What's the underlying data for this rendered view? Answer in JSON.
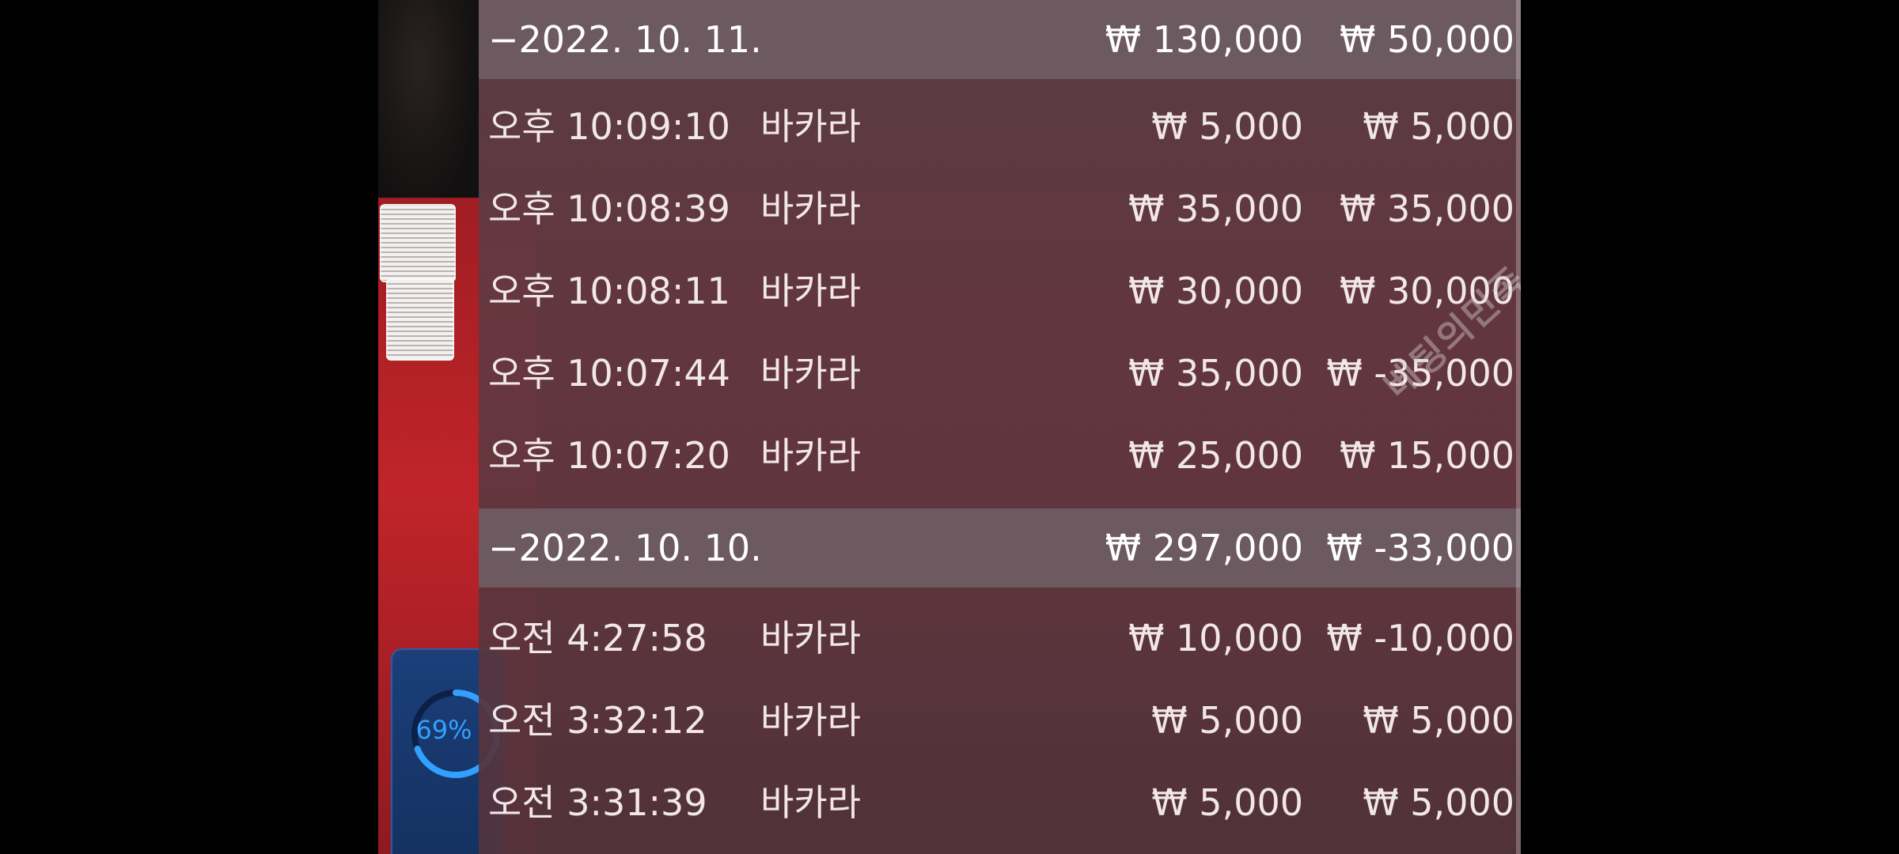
{
  "timer": {
    "percent_text": "69%",
    "progress": 0.69,
    "color": "#33a0ff"
  },
  "watermark": "베팅의민족",
  "groups": [
    {
      "date": "−2022. 10. 11.",
      "total_bet": "₩ 130,000",
      "total_result": "₩ 50,000",
      "rows": [
        {
          "time": "오후 10:09:10",
          "game": "바카라",
          "bet": "₩ 5,000",
          "result": "₩ 5,000"
        },
        {
          "time": "오후 10:08:39",
          "game": "바카라",
          "bet": "₩ 35,000",
          "result": "₩ 35,000"
        },
        {
          "time": "오후 10:08:11",
          "game": "바카라",
          "bet": "₩ 30,000",
          "result": "₩ 30,000"
        },
        {
          "time": "오후 10:07:44",
          "game": "바카라",
          "bet": "₩ 35,000",
          "result": "₩ -35,000"
        },
        {
          "time": "오후 10:07:20",
          "game": "바카라",
          "bet": "₩ 25,000",
          "result": "₩ 15,000"
        }
      ]
    },
    {
      "date": "−2022. 10. 10.",
      "total_bet": "₩ 297,000",
      "total_result": "₩ -33,000",
      "rows": [
        {
          "time": "오전 4:27:58",
          "game": "바카라",
          "bet": "₩ 10,000",
          "result": "₩ -10,000"
        },
        {
          "time": "오전 3:32:12",
          "game": "바카라",
          "bet": "₩ 5,000",
          "result": "₩ 5,000"
        },
        {
          "time": "오전 3:31:39",
          "game": "바카라",
          "bet": "₩ 5,000",
          "result": "₩ 5,000"
        }
      ]
    }
  ]
}
